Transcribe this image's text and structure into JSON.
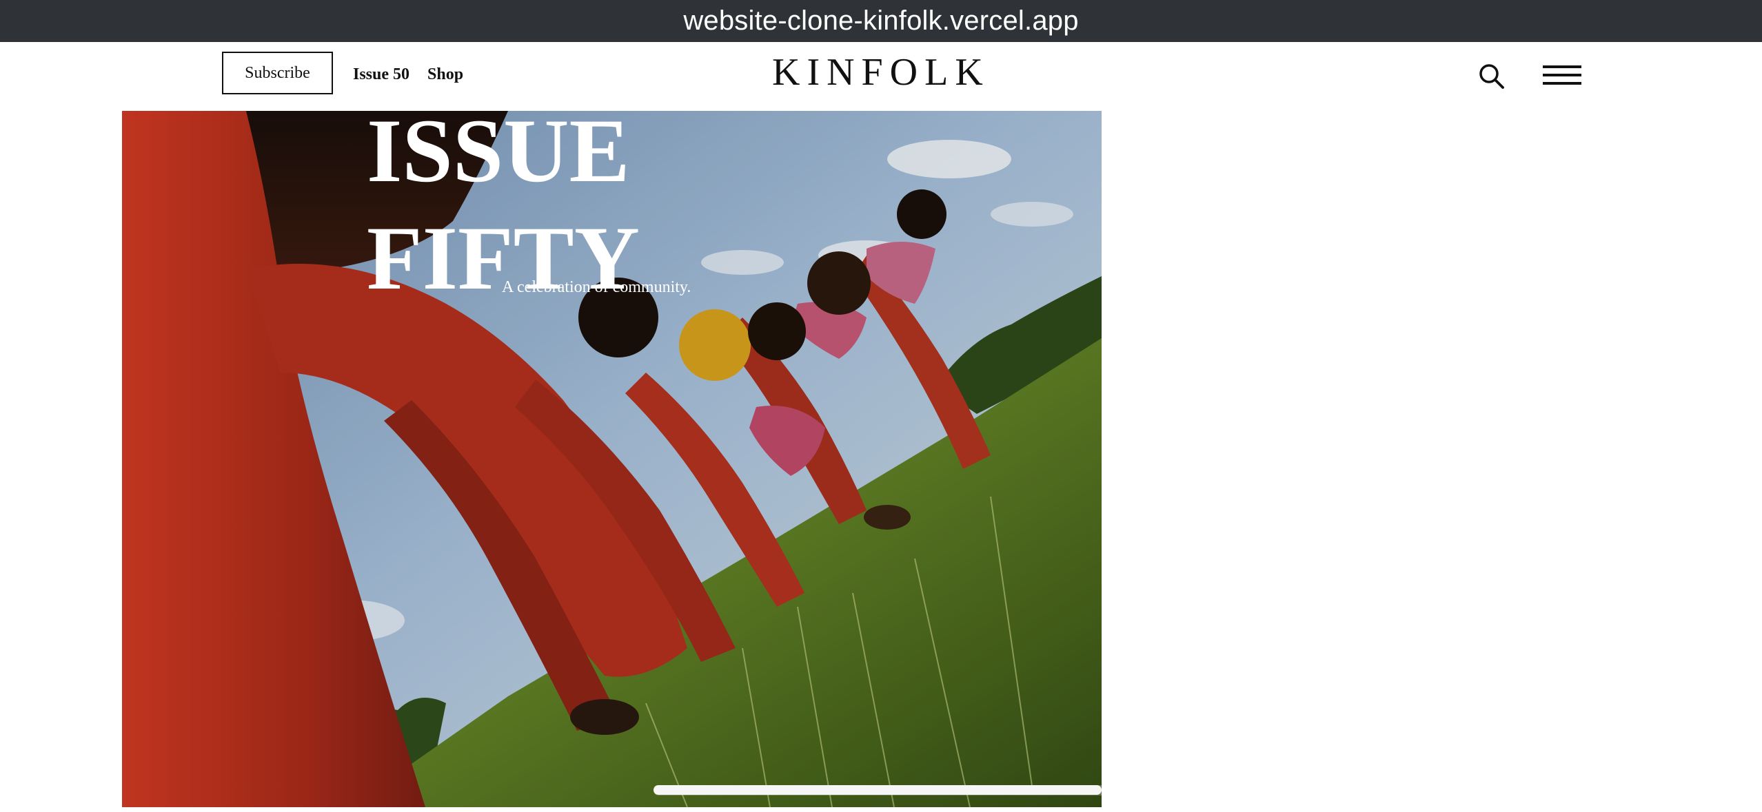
{
  "browser": {
    "url": "website-clone-kinfolk.vercel.app"
  },
  "header": {
    "subscribe_label": "Subscribe",
    "nav": [
      {
        "label": "Issue 50"
      },
      {
        "label": "Shop"
      }
    ],
    "logo": "KINFOLK",
    "icons": {
      "search": "search-icon",
      "menu": "hamburger-menu-icon"
    }
  },
  "hero": {
    "title_line1": "ISSUE",
    "title_line2": "FIFTY",
    "subtitle": "A celebration of community."
  },
  "colors": {
    "url_bar": "#2f3337",
    "text_dark": "#111111",
    "hero_red": "#b8281a",
    "grass": "#6a8a26",
    "sky": "#8fb3d6"
  }
}
